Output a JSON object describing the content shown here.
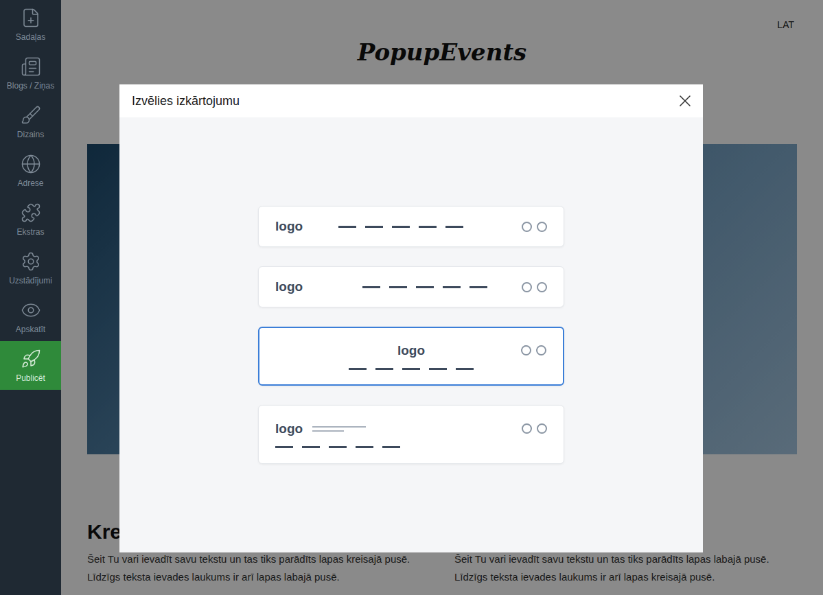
{
  "sidebar": {
    "items": [
      {
        "label": "Sadaļas",
        "selected": false
      },
      {
        "label": "Blogs / Ziņas",
        "selected": false
      },
      {
        "label": "Dizains",
        "selected": false
      },
      {
        "label": "Adrese",
        "selected": false
      },
      {
        "label": "Ekstras",
        "selected": false
      },
      {
        "label": "Uzstādījumi",
        "selected": false
      },
      {
        "label": "Apskatīt",
        "selected": false
      },
      {
        "label": "Publicēt",
        "selected": true
      }
    ]
  },
  "page": {
    "language": "LAT",
    "logo": "PopupEvents",
    "heading": "Krei",
    "columns": [
      {
        "lines": [
          "Šeit Tu vari ievadīt savu tekstu un tas tiks parādīts lapas kreisajā pusē.",
          "Līdzīgs teksta ievades laukums ir arī lapas labajā pusē."
        ]
      },
      {
        "lines": [
          "Šeit Tu vari ievadīt savu tekstu un tas tiks parādīts lapas labajā pusē.",
          "Līdzīgs teksta ievades laukums ir arī lapas kreisajā pusē."
        ]
      }
    ]
  },
  "dialog": {
    "title": "Izvēlies izkārtojumu",
    "layouts": [
      {
        "kind": "inline",
        "logo": "logo",
        "selected": false
      },
      {
        "kind": "split",
        "logo": "logo",
        "selected": false
      },
      {
        "kind": "centered",
        "logo": "logo",
        "selected": true
      },
      {
        "kind": "stacked",
        "logo": "logo",
        "selected": false
      }
    ]
  }
}
